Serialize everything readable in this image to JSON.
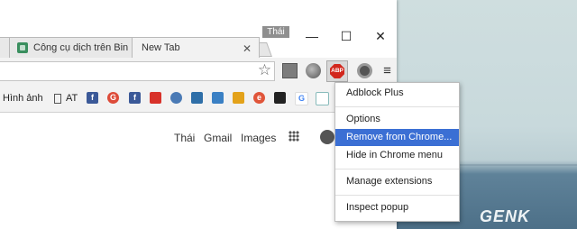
{
  "window": {
    "profile_name": "Thái",
    "controls": [
      "—",
      "☐",
      "✕"
    ],
    "tabs": [
      {
        "label": "",
        "active": false
      },
      {
        "label": "Công cụ dịch trên Bin",
        "active": false
      },
      {
        "label": "New Tab",
        "active": true
      }
    ]
  },
  "toolbar": {
    "star": "☆",
    "abp_label": "ABP",
    "menu_glyph": "≡"
  },
  "bookmarks": {
    "items": [
      {
        "label": "Hình ảnh"
      },
      {
        "label": "AT"
      }
    ],
    "icons": [
      "f",
      "G",
      "f",
      "",
      "",
      "",
      "",
      "",
      "e",
      "",
      "G",
      ""
    ]
  },
  "newtab": {
    "links": [
      "Thái",
      "Gmail",
      "Images"
    ]
  },
  "popup": {
    "items": [
      {
        "label": "Adblock Plus",
        "selected": false
      },
      {
        "label": "Options",
        "selected": false
      },
      {
        "label": "Remove from Chrome...",
        "selected": true
      },
      {
        "label": "Hide in Chrome menu",
        "selected": false
      },
      {
        "label": "Manage extensions",
        "selected": false
      },
      {
        "label": "Inspect popup",
        "selected": false
      }
    ]
  },
  "watermark": "GENK",
  "colors": {
    "selection": "#3b6fd4",
    "abp_red": "#d2261c"
  }
}
